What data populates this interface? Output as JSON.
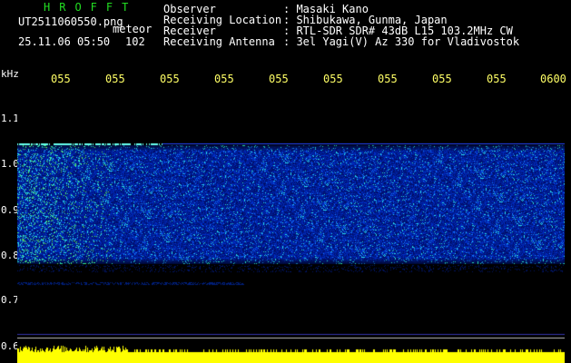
{
  "header": {
    "station_name": "HROFFT",
    "filename": "UT2511060550.png",
    "mode": "meteor",
    "datetime": "25.11.06 05:50",
    "count": "102"
  },
  "info": [
    {
      "label": "Observer",
      "value": ": Masaki Kano"
    },
    {
      "label": "Receiving Location",
      "value": ": Shibukawa, Gunma, Japan"
    },
    {
      "label": "Receiver",
      "value": ": RTL-SDR SDR# 43dB L15 103.2MHz CW"
    },
    {
      "label": "Receiving Antenna",
      "value": ": 3el Yagi(V) Az 330 for Vladivostok"
    }
  ],
  "y_axis": {
    "unit": "kHz",
    "ticks": [
      "1.1",
      "1.0",
      "0.9",
      "0.8",
      "0.7",
      "0.6"
    ]
  },
  "x_axis": {
    "ticks": [
      "055",
      "055",
      "055",
      "055",
      "055",
      "055",
      "055",
      "055",
      "055",
      "0600"
    ]
  },
  "colors": {
    "header_green": "#22dd22",
    "axis_yellow": "#ffff66",
    "spectrum_bg": "#08103a",
    "noise_blue": "#1a3cff",
    "signal_cyan": "#33ddee",
    "signal_green": "#66ff66",
    "bottom_bar": "#ffff00"
  }
}
